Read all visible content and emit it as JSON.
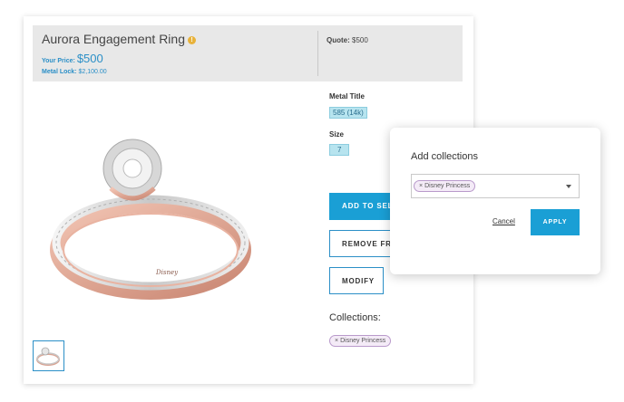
{
  "product": {
    "title": "Aurora Engagement Ring",
    "info_icon": "info-icon",
    "your_price_label": "Your Price:",
    "your_price": "$500",
    "metal_lock_label": "Metal Lock:",
    "metal_lock": "$2,100.00",
    "quote_label": "Quote:",
    "quote": "$500",
    "image_icon": "ring-image"
  },
  "specs": {
    "metal_title_label": "Metal Title",
    "metal_title_value": "585 (14k)",
    "size_label": "Size",
    "size_value": "7"
  },
  "actions": {
    "add_label": "ADD TO SELECTION",
    "remove_label": "REMOVE FROM SELECTION",
    "modify_label": "MODIFY"
  },
  "collections": {
    "heading": "Collections:",
    "items": [
      "Disney Princess"
    ],
    "remove_glyph": "×"
  },
  "popup": {
    "title": "Add collections",
    "selected": [
      "Disney Princess"
    ],
    "cancel_label": "Cancel",
    "apply_label": "APPLY"
  },
  "colors": {
    "accent": "#1a9fd5",
    "price": "#2b8fc7",
    "chip_bg": "#b7e4ef",
    "tag_bg": "#f4ebf7",
    "header_bg": "#e8e8e8"
  }
}
